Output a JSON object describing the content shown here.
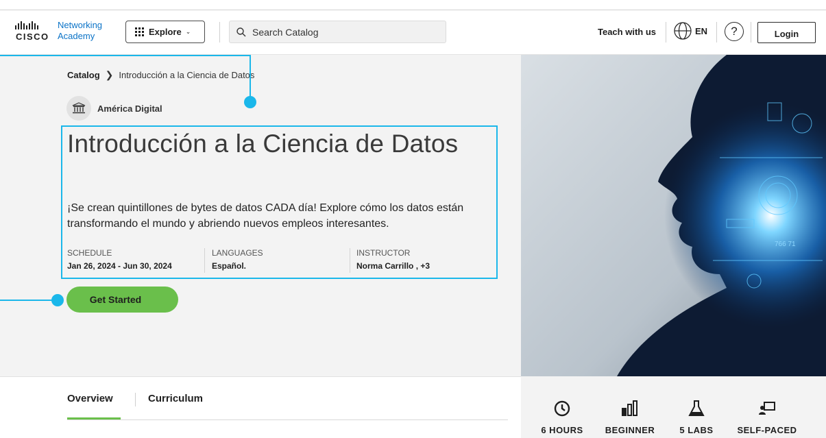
{
  "header": {
    "logo_brand": "cisco",
    "logo_line1": "Networking",
    "logo_line2": "Academy",
    "explore_label": "Explore",
    "search_placeholder": "Search Catalog",
    "teach_label": "Teach with us",
    "language_label": "EN",
    "help_label": "?",
    "login_label": "Login"
  },
  "breadcrumb": {
    "root": "Catalog",
    "current": "Introducción a la Ciencia de Datos"
  },
  "organization": "América Digital",
  "course": {
    "title": "Introducción a la Ciencia de Datos",
    "description": "¡Se crean quintillones de bytes de datos CADA día! Explore cómo los datos están transformando el mundo y abriendo nuevos empleos interesantes.",
    "schedule_label": "SCHEDULE",
    "schedule_value": "Jan 26, 2024 - Jun 30, 2024",
    "languages_label": "LANGUAGES",
    "languages_value": "Español.",
    "instructor_label": "INSTRUCTOR",
    "instructor_value": "Norma Carrillo , +3",
    "cta_label": "Get Started"
  },
  "tabs": [
    "Overview",
    "Curriculum"
  ],
  "stats": [
    {
      "icon": "clock-icon",
      "label": "6 HOURS"
    },
    {
      "icon": "level-bars-icon",
      "label": "BEGINNER"
    },
    {
      "icon": "flask-icon",
      "label": "5 LABS"
    },
    {
      "icon": "self-paced-icon",
      "label": "SELF-PACED"
    }
  ],
  "hero_image_overlay_text": "766 71",
  "colors": {
    "accent_green": "#6abf4b",
    "callout_blue": "#1ab7ea",
    "cisco_blue": "#0b73c7",
    "hero_bg": "#f3f3f3"
  }
}
